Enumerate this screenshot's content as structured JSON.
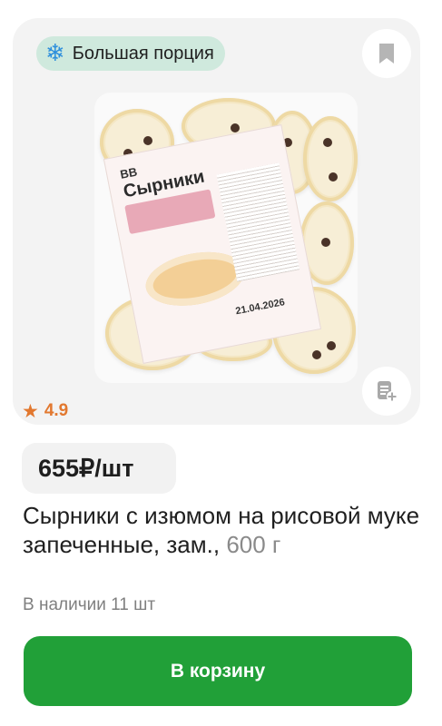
{
  "badge": {
    "icon": "snowflake-icon",
    "text": "Большая порция",
    "accent": "#2f8fdc",
    "bg": "#cfe9dd"
  },
  "actions": {
    "bookmark_icon": "bookmark-icon",
    "list_icon": "shopping-list-add-icon"
  },
  "packaging": {
    "brand": "BB",
    "name": "Сырники",
    "date": "21.04.2026"
  },
  "rating": {
    "icon": "star-icon",
    "value": "4.9",
    "color": "#e2782f"
  },
  "price": "655₽/шт",
  "title": {
    "name": "Сырники с изюмом на рисовой муке запеченные, зам.",
    "weight": "600 г"
  },
  "stock": "В наличии 11 шт",
  "cart_button": {
    "label": "В корзину",
    "color": "#21a038"
  }
}
